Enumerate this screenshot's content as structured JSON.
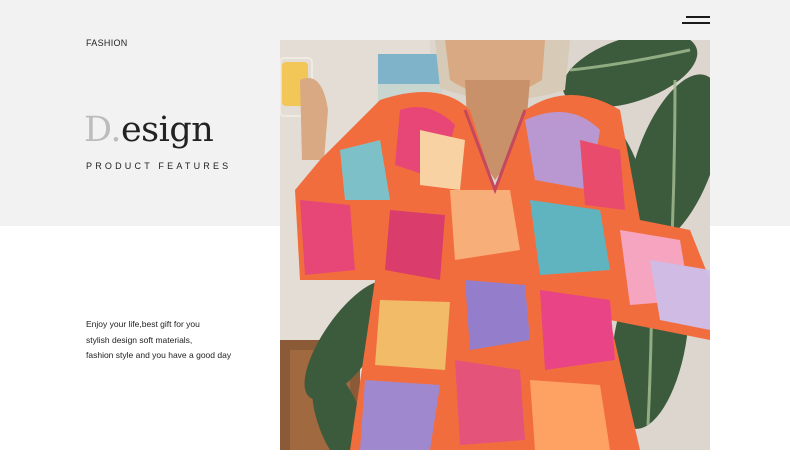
{
  "header": {
    "category": "FASHION",
    "menu_icon": "menu-icon"
  },
  "hero": {
    "headline_initial": "D.",
    "headline_rest": "esign",
    "subheadline": "PRODUCT FEATURES"
  },
  "tagline": {
    "lines": [
      "Enjoy your life,best gift for you",
      "stylish design soft materials,",
      "fashion style and you have a good day"
    ]
  },
  "photo": {
    "subject": "model-in-colorful-patterned-dress",
    "colors": {
      "background": "#f2f2f2",
      "text": "#222222",
      "initial": "#bcbcbc"
    }
  }
}
